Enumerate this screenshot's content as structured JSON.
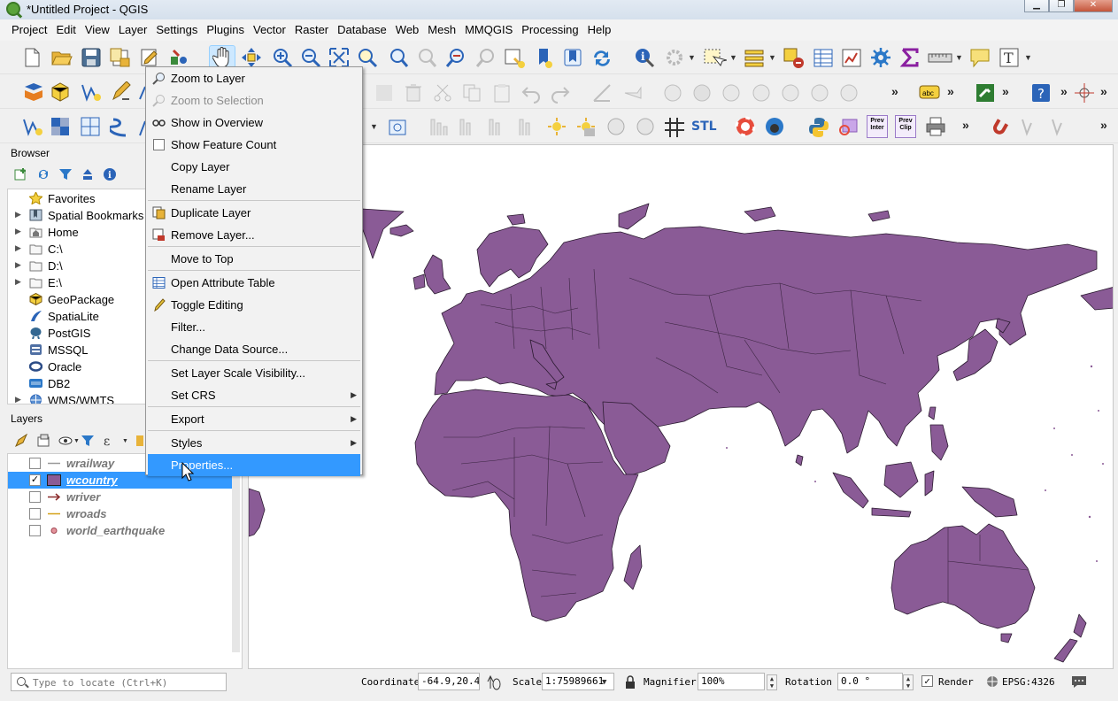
{
  "window": {
    "title": "*Untitled Project - QGIS",
    "controls": [
      "▁",
      "❐",
      "✕"
    ]
  },
  "menubar": [
    "Project",
    "Edit",
    "View",
    "Layer",
    "Settings",
    "Plugins",
    "Vector",
    "Raster",
    "Database",
    "Web",
    "Mesh",
    "MMQGIS",
    "Processing",
    "Help"
  ],
  "toolbar3_labels": {
    "stl": "STL",
    "prev_inter": "Prev Inter",
    "prev_clip": "Prev Clip"
  },
  "browser": {
    "title": "Browser",
    "items": [
      {
        "label": "Favorites",
        "icon": "star-icon",
        "arrow": ""
      },
      {
        "label": "Spatial Bookmarks",
        "icon": "bookmarks-icon",
        "arrow": "▶"
      },
      {
        "label": "Home",
        "icon": "home-folder-icon",
        "arrow": "▶"
      },
      {
        "label": "C:\\",
        "icon": "folder-icon",
        "arrow": "▶"
      },
      {
        "label": "D:\\",
        "icon": "folder-icon",
        "arrow": "▶"
      },
      {
        "label": "E:\\",
        "icon": "folder-icon",
        "arrow": "▶"
      },
      {
        "label": "GeoPackage",
        "icon": "geopackage-icon",
        "arrow": ""
      },
      {
        "label": "SpatiaLite",
        "icon": "spatialite-icon",
        "arrow": ""
      },
      {
        "label": "PostGIS",
        "icon": "postgis-icon",
        "arrow": ""
      },
      {
        "label": "MSSQL",
        "icon": "mssql-icon",
        "arrow": ""
      },
      {
        "label": "Oracle",
        "icon": "oracle-icon",
        "arrow": ""
      },
      {
        "label": "DB2",
        "icon": "db2-icon",
        "arrow": ""
      },
      {
        "label": "WMS/WMTS",
        "icon": "wms-icon",
        "arrow": "▶"
      }
    ]
  },
  "layers": {
    "title": "Layers",
    "items": [
      {
        "label": "wrailway",
        "checked": false,
        "selected": false,
        "symbol": "line-gray"
      },
      {
        "label": "wcountry",
        "checked": true,
        "selected": true,
        "symbol": "polygon-purple"
      },
      {
        "label": "wriver",
        "checked": false,
        "selected": false,
        "symbol": "line-arrow"
      },
      {
        "label": "wroads",
        "checked": false,
        "selected": false,
        "symbol": "line-orange"
      },
      {
        "label": "world_earthquake",
        "checked": false,
        "selected": false,
        "symbol": "point-pink"
      }
    ]
  },
  "context_menu": {
    "items": [
      {
        "label": "Zoom to Layer",
        "icon": "zoom-to-layer-icon",
        "disabled": false
      },
      {
        "label": "Zoom to Selection",
        "icon": "zoom-to-selection-icon",
        "disabled": true
      },
      {
        "label": "Show in Overview",
        "icon": "overview-icon",
        "disabled": false
      },
      {
        "label": "Show Feature Count",
        "icon": "checkbox-icon",
        "disabled": false
      },
      {
        "label": "Copy Layer",
        "icon": "",
        "disabled": false
      },
      {
        "label": "Rename Layer",
        "icon": "",
        "disabled": false
      },
      {
        "label": "Duplicate Layer",
        "icon": "duplicate-icon",
        "disabled": false
      },
      {
        "label": "Remove Layer...",
        "icon": "remove-layer-icon",
        "disabled": false
      },
      {
        "label": "Move to Top",
        "icon": "",
        "disabled": false
      },
      {
        "label": "Open Attribute Table",
        "icon": "attribute-table-icon",
        "disabled": false
      },
      {
        "label": "Toggle Editing",
        "icon": "pencil-icon",
        "disabled": false
      },
      {
        "label": "Filter...",
        "icon": "",
        "disabled": false
      },
      {
        "label": "Change Data Source...",
        "icon": "",
        "disabled": false
      },
      {
        "label": "Set Layer Scale Visibility...",
        "icon": "",
        "disabled": false
      },
      {
        "label": "Set CRS",
        "icon": "",
        "disabled": false,
        "submenu": true
      },
      {
        "label": "Export",
        "icon": "",
        "disabled": false,
        "submenu": true
      },
      {
        "label": "Styles",
        "icon": "",
        "disabled": false,
        "submenu": true
      },
      {
        "label": "Properties...",
        "icon": "",
        "disabled": false,
        "highlighted": true
      }
    ]
  },
  "statusbar": {
    "locate_placeholder": "Type to locate (Ctrl+K)",
    "coordinate_label": "Coordinate",
    "coordinate_value": "-64.9,20.4",
    "scale_label": "Scale",
    "scale_value": "1:75989661",
    "magnifier_label": "Magnifier",
    "magnifier_value": "100%",
    "rotation_label": "Rotation",
    "rotation_value": "0.0 °",
    "render_label": "Render",
    "render_checked": "✓",
    "crs": "EPSG:4326"
  },
  "colors": {
    "land": "#8a5b96",
    "land_outline": "#2b1a30",
    "selection": "#3399ff",
    "menu_highlight": "#3399ff"
  }
}
